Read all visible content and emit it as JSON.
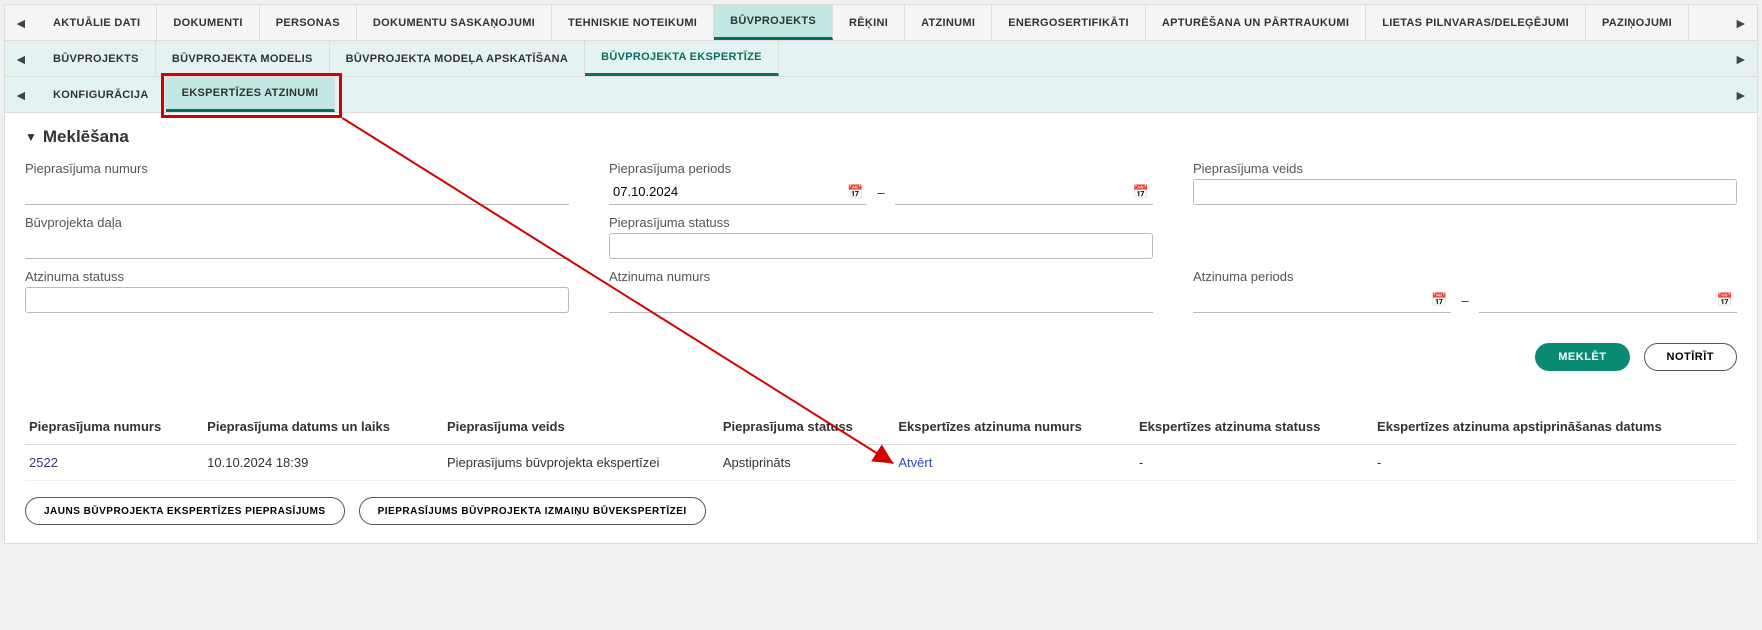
{
  "tabs_level1": [
    "Aktuālie dati",
    "Dokumenti",
    "Personas",
    "Dokumentu saskaņojumi",
    "Tehniskie noteikumi",
    "Būvprojekts",
    "Rēķini",
    "Atzinumi",
    "Energosertifikāti",
    "Apturēšana un pārtraukumi",
    "Lietas pilnvaras/deleģējumi",
    "Paziņojumi"
  ],
  "tabs_level1_active_index": 5,
  "tabs_level2": [
    "Būvprojekts",
    "Būvprojekta modelis",
    "Būvprojekta modeļa apskatīšana",
    "Būvprojekta ekspertīze"
  ],
  "tabs_level2_active_index": 3,
  "tabs_level3": [
    "Konfigurācija",
    "Ekspertīzes atzinumi"
  ],
  "tabs_level3_active_index": 1,
  "section_title": "Meklēšana",
  "filters": {
    "request_number_label": "Pieprasījuma numurs",
    "request_period_label": "Pieprasījuma periods",
    "request_period_from": "07.10.2024",
    "request_type_label": "Pieprasījuma veids",
    "project_part_label": "Būvprojekta daļa",
    "request_status_label": "Pieprasījuma statuss",
    "opinion_status_label": "Atzinuma statuss",
    "opinion_number_label": "Atzinuma numurs",
    "opinion_period_label": "Atzinuma periods"
  },
  "buttons": {
    "search": "Meklēt",
    "clear": "Notīrīt",
    "new_request": "Jauns būvprojekta ekspertīzes pieprasījums",
    "changes_request": "Pieprasījums būvprojekta izmaiņu būvekspertīzei"
  },
  "table": {
    "headers": [
      "Pieprasījuma numurs",
      "Pieprasījuma datums un laiks",
      "Pieprasījuma veids",
      "Pieprasījuma statuss",
      "Ekspertīzes atzinuma numurs",
      "Ekspertīzes atzinuma statuss",
      "Ekspertīzes atzinuma apstiprināšanas datums"
    ],
    "row": {
      "number": "2522",
      "datetime": "10.10.2024 18:39",
      "type": "Pieprasījums būvprojekta ekspertīzei",
      "status": "Apstiprināts",
      "opinion_number": "Atvērt",
      "opinion_status": "-",
      "opinion_date": "-"
    }
  }
}
